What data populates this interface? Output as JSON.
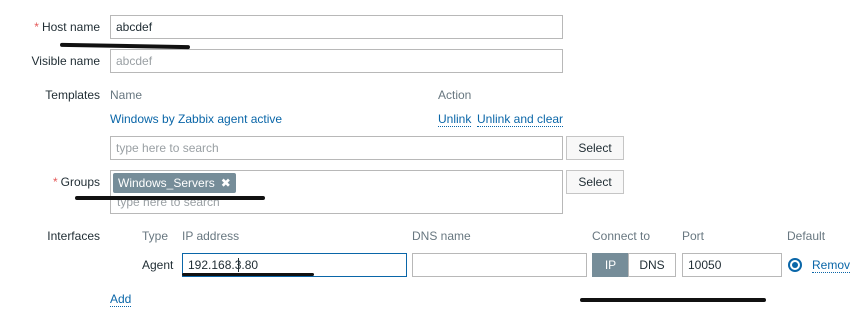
{
  "host_name": {
    "label": "Host name",
    "required": "*",
    "value": "abcdef"
  },
  "visible_name": {
    "label": "Visible name",
    "placeholder": "abcdef"
  },
  "templates": {
    "label": "Templates",
    "col_name": "Name",
    "col_action": "Action",
    "rows": [
      {
        "name": "Windows by Zabbix agent active",
        "unlink": "Unlink",
        "unlink_clear": "Unlink and clear"
      }
    ],
    "search_placeholder": "type here to search",
    "select_label": "Select"
  },
  "groups": {
    "label": "Groups",
    "required": "*",
    "chips": [
      "Windows_Servers"
    ],
    "chip_remove": "✖",
    "search_placeholder": "type here to search",
    "select_label": "Select"
  },
  "interfaces": {
    "label": "Interfaces",
    "col_type": "Type",
    "col_ip": "IP address",
    "col_dns": "DNS name",
    "col_connect": "Connect to",
    "col_port": "Port",
    "col_default": "Default",
    "rows": [
      {
        "type": "Agent",
        "ip": "192.168.3.80",
        "dns": "",
        "connect_ip": "IP",
        "connect_dns": "DNS",
        "port": "10050",
        "remove": "Remov"
      }
    ],
    "add_label": "Add"
  },
  "colors": {
    "link": "#0a66a8",
    "required": "#e45959",
    "chip_bg": "#768d99",
    "border": "#b8b8b8"
  }
}
